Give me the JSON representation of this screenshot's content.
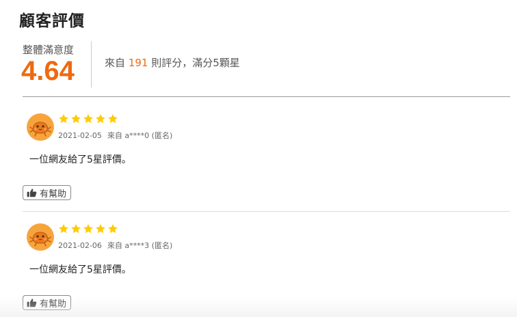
{
  "title": "顧客評價",
  "summary": {
    "label": "整體滿意度",
    "score": "4.64",
    "text_prefix": "來自",
    "count": "191",
    "text_suffix": "則評分，滿分5顆星"
  },
  "colors": {
    "accent": "#ee6a10",
    "star": "#ffcc00",
    "avatar": "#f7a43c"
  },
  "reviews": [
    {
      "rating": 5,
      "date": "2021-02-05",
      "source": "來自 a****0 (匿名)",
      "body": "一位網友給了5星評價。",
      "avatar_icon": "orange-crab-avatar-icon",
      "helpful_icon": "thumbs-up-icon",
      "helpful_label": "有幫助"
    },
    {
      "rating": 5,
      "date": "2021-02-06",
      "source": "來自 a****3 (匿名)",
      "body": "一位網友給了5星評價。",
      "avatar_icon": "orange-crab-avatar-icon",
      "helpful_icon": "thumbs-up-icon",
      "helpful_label": "有幫助"
    }
  ]
}
